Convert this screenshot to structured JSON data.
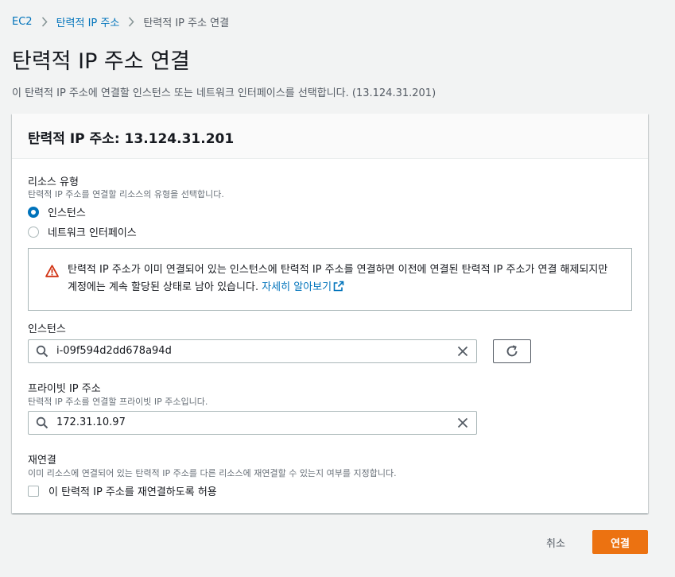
{
  "breadcrumb": {
    "items": [
      "EC2",
      "탄력적 IP 주소",
      "탄력적 IP 주소 연결"
    ]
  },
  "page": {
    "title": "탄력적 IP 주소 연결",
    "description": "이 탄력적 IP 주소에 연결할 인스턴스 또는 네트워크 인터페이스를 선택합니다. (13.124.31.201)"
  },
  "panel": {
    "title": "탄력적 IP 주소: 13.124.31.201"
  },
  "resource_type": {
    "label": "리소스 유형",
    "description": "탄력적 IP 주소를 연결할 리소스의 유형을 선택합니다.",
    "options": [
      {
        "label": "인스턴스",
        "selected": true
      },
      {
        "label": "네트워크 인터페이스",
        "selected": false
      }
    ]
  },
  "alert": {
    "text": "탄력적 IP 주소가 이미 연결되어 있는 인스턴스에 탄력적 IP 주소를 연결하면 이전에 연결된 탄력적 IP 주소가 연결 해제되지만 계정에는 계속 할당된 상태로 남아 있습니다. ",
    "link": "자세히 알아보기",
    "icon": "warning-icon",
    "color": "#d13212"
  },
  "instance": {
    "label": "인스턴스",
    "value": "i-09f594d2dd678a94d"
  },
  "private_ip": {
    "label": "프라이빗 IP 주소",
    "description": "탄력적 IP 주소를 연결할 프라이빗 IP 주소입니다.",
    "value": "172.31.10.97"
  },
  "reassociation": {
    "label": "재연결",
    "description": "이미 리소스에 연결되어 있는 탄력적 IP 주소를 다른 리소스에 재연결할 수 있는지 여부를 지정합니다.",
    "checkbox_label": "이 탄력적 IP 주소를 재연결하도록 허용",
    "checked": false
  },
  "actions": {
    "cancel": "취소",
    "confirm": "연결",
    "confirm_color": "#ec7211"
  },
  "theme": {
    "link_color": "#0073bb",
    "background": "#f2f3f3"
  }
}
